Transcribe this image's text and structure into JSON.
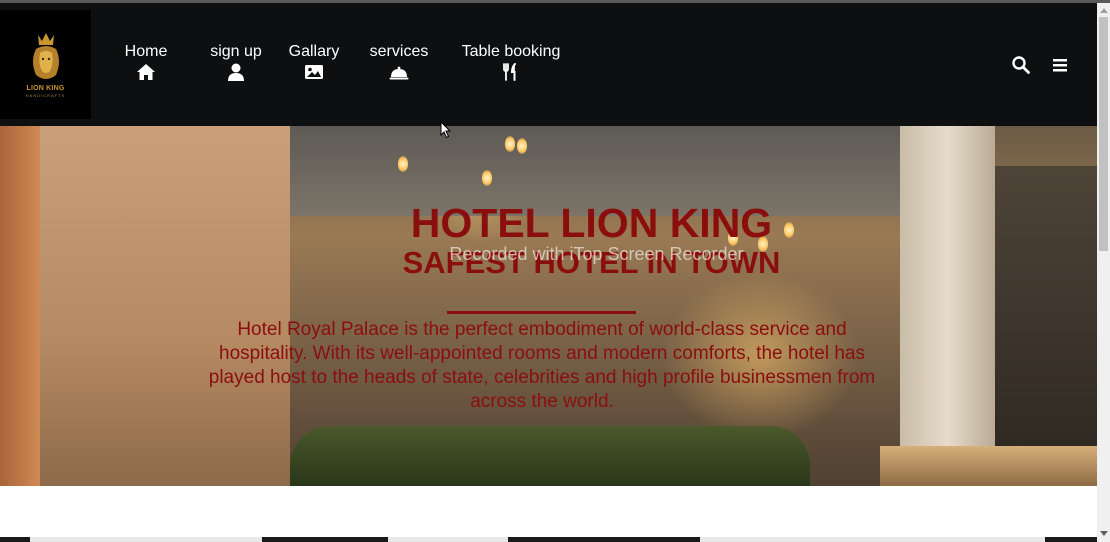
{
  "logo": {
    "name": "LION KING",
    "tagline": "HANDICRAFTS"
  },
  "nav": {
    "items": [
      {
        "label": "Home",
        "icon": "home-icon"
      },
      {
        "label": "sign up",
        "icon": "user-icon"
      },
      {
        "label": "Gallary",
        "icon": "image-icon"
      },
      {
        "label": "services",
        "icon": "cloche-icon"
      },
      {
        "label": "Table booking",
        "icon": "utensils-icon"
      }
    ],
    "search_icon": "search-icon",
    "menu_icon": "hamburger-menu-icon"
  },
  "hero": {
    "title": "HOTEL LION KING",
    "subtitle": "SAFEST HOTEL IN TOWN",
    "watermark": "Recorded with iTop Screen Recorder",
    "description": "Hotel Royal Palace is the perfect embodiment of world-class service and hospitality. With its well-appointed rooms and modern comforts, the hotel has played host to the heads of state, celebrities and high profile businessmen from across the world."
  },
  "colors": {
    "accent": "#8b0e0e",
    "navbar": "#0d0f10",
    "logo_gold": "#c9962e"
  }
}
